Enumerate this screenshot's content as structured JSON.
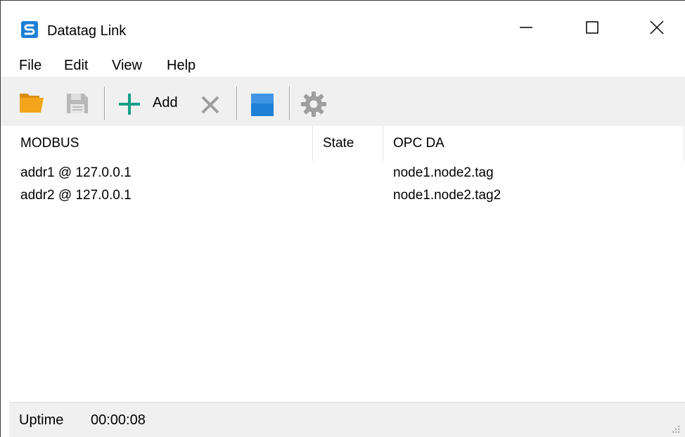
{
  "window": {
    "title": "Datatag Link",
    "app_icon": "s-logo-icon"
  },
  "menu": {
    "items": [
      "File",
      "Edit",
      "View",
      "Help"
    ]
  },
  "toolbar": {
    "open_icon": "folder-open-icon",
    "save_icon": "save-disk-icon",
    "add_icon": "plus-icon",
    "add_label": "Add",
    "delete_icon": "delete-x-icon",
    "stop_icon": "stop-square-icon",
    "settings_icon": "gear-icon"
  },
  "list": {
    "columns": [
      "MODBUS",
      "State",
      "OPC DA"
    ],
    "rows": [
      {
        "modbus": "addr1 @ 127.0.0.1",
        "state": "",
        "opc": "node1.node2.tag"
      },
      {
        "modbus": "addr2 @ 127.0.0.1",
        "state": "",
        "opc": "node1.node2.tag2"
      }
    ]
  },
  "status": {
    "label": "Uptime",
    "value": "00:00:08"
  },
  "colors": {
    "accent_blue": "#1e7fd6",
    "add_green": "#16a085",
    "folder_orange": "#f2a51a",
    "disabled_gray": "#9e9e9e",
    "toolbar_bg": "#f0f0f0"
  }
}
